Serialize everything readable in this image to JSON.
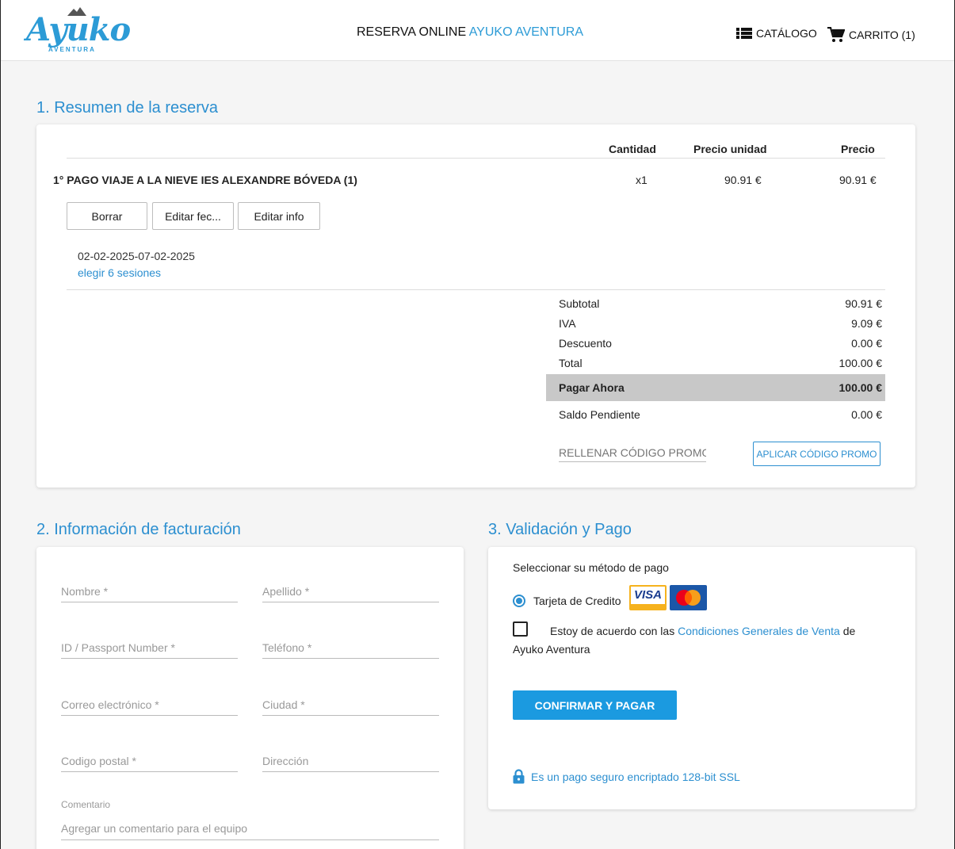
{
  "header": {
    "logo_text": "Ayuko",
    "logo_sub": "AVENTURA",
    "title_prefix": "RESERVA ONLINE",
    "title_accent": "AYUKO AVENTURA",
    "catalog_label": "CATÁLOGO",
    "cart_label": "CARRITO (1)"
  },
  "summary": {
    "title": "1. Resumen de la reserva",
    "columns": {
      "quantity": "Cantidad",
      "unit_price": "Precio unidad",
      "price": "Precio"
    },
    "item": {
      "name": "1° PAGO VIAJE A LA NIEVE IES ALEXANDRE BÓVEDA (1)",
      "quantity": "x1",
      "unit_price": "90.91 €",
      "price": "90.91 €",
      "dates": "02-02-2025-07-02-2025",
      "sessions_link": "elegir 6 sesiones"
    },
    "buttons": {
      "delete": "Borrar",
      "edit_dates": "Editar fec...",
      "edit_info": "Editar info"
    },
    "totals": {
      "subtotal_label": "Subtotal",
      "subtotal": "90.91 €",
      "iva_label": "IVA",
      "iva": "9.09 €",
      "discount_label": "Descuento",
      "discount": "0.00 €",
      "total_label": "Total",
      "total": "100.00 €",
      "pay_now_label": "Pagar Ahora",
      "pay_now": "100.00 €",
      "pending_label": "Saldo Pendiente",
      "pending": "0.00 €"
    },
    "promo_placeholder": "RELLENAR CÓDIGO PROMO AQUÍ",
    "promo_button": "APLICAR CÓDIGO PROMO"
  },
  "billing": {
    "title": "2. Información de facturación",
    "fields": {
      "nombre": "Nombre *",
      "apellido": "Apellido *",
      "id": "ID / Passport Number *",
      "telefono": "Teléfono *",
      "email": "Correo electrónico *",
      "ciudad": "Ciudad *",
      "postal": "Codigo postal *",
      "direccion": "Dirección"
    },
    "comment_label": "Comentario",
    "comment_placeholder": "Agregar un comentario para el equipo"
  },
  "payment": {
    "title": "3. Validación y Pago",
    "method_label": "Seleccionar su método de pago",
    "card_option": "Tarjeta de Credito",
    "visa_text": "VISA",
    "terms_prefix": "Estoy de acuerdo con las",
    "terms_link": "Condiciones Generales de Venta",
    "terms_suffix": "de Ayuko Aventura",
    "confirm_button": "CONFIRMAR Y PAGAR",
    "secure_text": "Es un pago seguro encriptado 128-bit SSL"
  },
  "colors": {
    "accent": "#2c8fd0",
    "button": "#1b9ae0",
    "pay_now_bg": "#c8c8c8"
  }
}
